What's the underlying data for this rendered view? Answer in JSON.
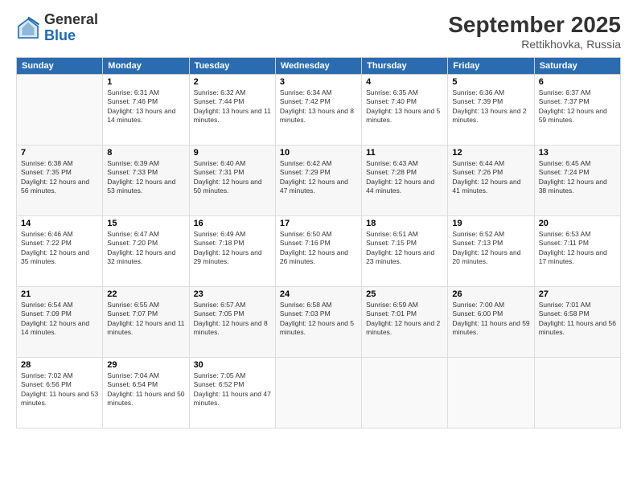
{
  "header": {
    "logo_line1": "General",
    "logo_line2": "Blue",
    "month_title": "September 2025",
    "subtitle": "Rettikhovka, Russia"
  },
  "days_of_week": [
    "Sunday",
    "Monday",
    "Tuesday",
    "Wednesday",
    "Thursday",
    "Friday",
    "Saturday"
  ],
  "weeks": [
    [
      {
        "day": "",
        "empty": true
      },
      {
        "day": "1",
        "sunrise": "6:31 AM",
        "sunset": "7:46 PM",
        "daylight": "13 hours and 14 minutes."
      },
      {
        "day": "2",
        "sunrise": "6:32 AM",
        "sunset": "7:44 PM",
        "daylight": "13 hours and 11 minutes."
      },
      {
        "day": "3",
        "sunrise": "6:34 AM",
        "sunset": "7:42 PM",
        "daylight": "13 hours and 8 minutes."
      },
      {
        "day": "4",
        "sunrise": "6:35 AM",
        "sunset": "7:40 PM",
        "daylight": "13 hours and 5 minutes."
      },
      {
        "day": "5",
        "sunrise": "6:36 AM",
        "sunset": "7:39 PM",
        "daylight": "13 hours and 2 minutes."
      },
      {
        "day": "6",
        "sunrise": "6:37 AM",
        "sunset": "7:37 PM",
        "daylight": "12 hours and 59 minutes."
      }
    ],
    [
      {
        "day": "7",
        "sunrise": "6:38 AM",
        "sunset": "7:35 PM",
        "daylight": "12 hours and 56 minutes."
      },
      {
        "day": "8",
        "sunrise": "6:39 AM",
        "sunset": "7:33 PM",
        "daylight": "12 hours and 53 minutes."
      },
      {
        "day": "9",
        "sunrise": "6:40 AM",
        "sunset": "7:31 PM",
        "daylight": "12 hours and 50 minutes."
      },
      {
        "day": "10",
        "sunrise": "6:42 AM",
        "sunset": "7:29 PM",
        "daylight": "12 hours and 47 minutes."
      },
      {
        "day": "11",
        "sunrise": "6:43 AM",
        "sunset": "7:28 PM",
        "daylight": "12 hours and 44 minutes."
      },
      {
        "day": "12",
        "sunrise": "6:44 AM",
        "sunset": "7:26 PM",
        "daylight": "12 hours and 41 minutes."
      },
      {
        "day": "13",
        "sunrise": "6:45 AM",
        "sunset": "7:24 PM",
        "daylight": "12 hours and 38 minutes."
      }
    ],
    [
      {
        "day": "14",
        "sunrise": "6:46 AM",
        "sunset": "7:22 PM",
        "daylight": "12 hours and 35 minutes."
      },
      {
        "day": "15",
        "sunrise": "6:47 AM",
        "sunset": "7:20 PM",
        "daylight": "12 hours and 32 minutes."
      },
      {
        "day": "16",
        "sunrise": "6:49 AM",
        "sunset": "7:18 PM",
        "daylight": "12 hours and 29 minutes."
      },
      {
        "day": "17",
        "sunrise": "6:50 AM",
        "sunset": "7:16 PM",
        "daylight": "12 hours and 26 minutes."
      },
      {
        "day": "18",
        "sunrise": "6:51 AM",
        "sunset": "7:15 PM",
        "daylight": "12 hours and 23 minutes."
      },
      {
        "day": "19",
        "sunrise": "6:52 AM",
        "sunset": "7:13 PM",
        "daylight": "12 hours and 20 minutes."
      },
      {
        "day": "20",
        "sunrise": "6:53 AM",
        "sunset": "7:11 PM",
        "daylight": "12 hours and 17 minutes."
      }
    ],
    [
      {
        "day": "21",
        "sunrise": "6:54 AM",
        "sunset": "7:09 PM",
        "daylight": "12 hours and 14 minutes."
      },
      {
        "day": "22",
        "sunrise": "6:55 AM",
        "sunset": "7:07 PM",
        "daylight": "12 hours and 11 minutes."
      },
      {
        "day": "23",
        "sunrise": "6:57 AM",
        "sunset": "7:05 PM",
        "daylight": "12 hours and 8 minutes."
      },
      {
        "day": "24",
        "sunrise": "6:58 AM",
        "sunset": "7:03 PM",
        "daylight": "12 hours and 5 minutes."
      },
      {
        "day": "25",
        "sunrise": "6:59 AM",
        "sunset": "7:01 PM",
        "daylight": "12 hours and 2 minutes."
      },
      {
        "day": "26",
        "sunrise": "7:00 AM",
        "sunset": "6:00 PM",
        "daylight": "11 hours and 59 minutes."
      },
      {
        "day": "27",
        "sunrise": "7:01 AM",
        "sunset": "6:58 PM",
        "daylight": "11 hours and 56 minutes."
      }
    ],
    [
      {
        "day": "28",
        "sunrise": "7:02 AM",
        "sunset": "6:56 PM",
        "daylight": "11 hours and 53 minutes."
      },
      {
        "day": "29",
        "sunrise": "7:04 AM",
        "sunset": "6:54 PM",
        "daylight": "11 hours and 50 minutes."
      },
      {
        "day": "30",
        "sunrise": "7:05 AM",
        "sunset": "6:52 PM",
        "daylight": "11 hours and 47 minutes."
      },
      {
        "day": "",
        "empty": true
      },
      {
        "day": "",
        "empty": true
      },
      {
        "day": "",
        "empty": true
      },
      {
        "day": "",
        "empty": true
      }
    ]
  ]
}
